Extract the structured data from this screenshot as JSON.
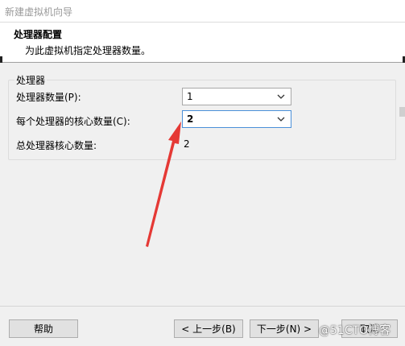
{
  "window": {
    "title": "新建虚拟机向导"
  },
  "header": {
    "title": "处理器配置",
    "subtitle": "为此虚拟机指定处理器数量。"
  },
  "group": {
    "label": "处理器",
    "processors_label": "处理器数量(P):",
    "processors_value": "1",
    "cores_label": "每个处理器的核心数量(C):",
    "cores_value": "2",
    "total_label": "总处理器核心数量:",
    "total_value": "2"
  },
  "buttons": {
    "help": "帮助",
    "back": "< 上一步(B)",
    "next": "下一步(N) >",
    "cancel": "取消"
  },
  "watermark": "@51CTO博客",
  "colors": {
    "annotation_arrow": "#e53935",
    "focus_border": "#4a90d9"
  },
  "icons": {
    "dropdown": "chevron-down-icon"
  }
}
